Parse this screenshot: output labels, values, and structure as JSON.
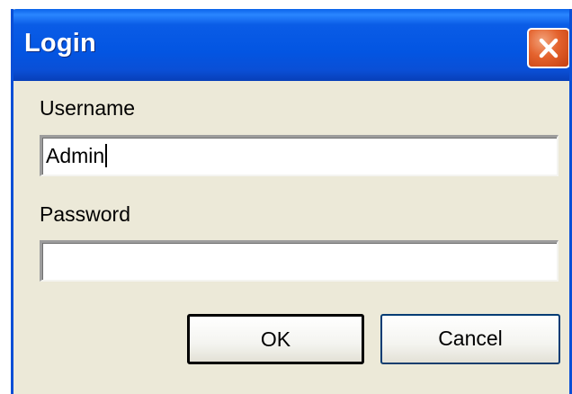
{
  "dialog": {
    "title": "Login",
    "close_icon": "close-icon",
    "username": {
      "label": "Username",
      "value": "Admin"
    },
    "password": {
      "label": "Password",
      "value": ""
    },
    "ok_label": "OK",
    "cancel_label": "Cancel"
  },
  "colors": {
    "titlebar": "#0355e2",
    "window_border": "#0a4fd6",
    "background": "#ece9d8",
    "close_button": "#e4622d"
  }
}
